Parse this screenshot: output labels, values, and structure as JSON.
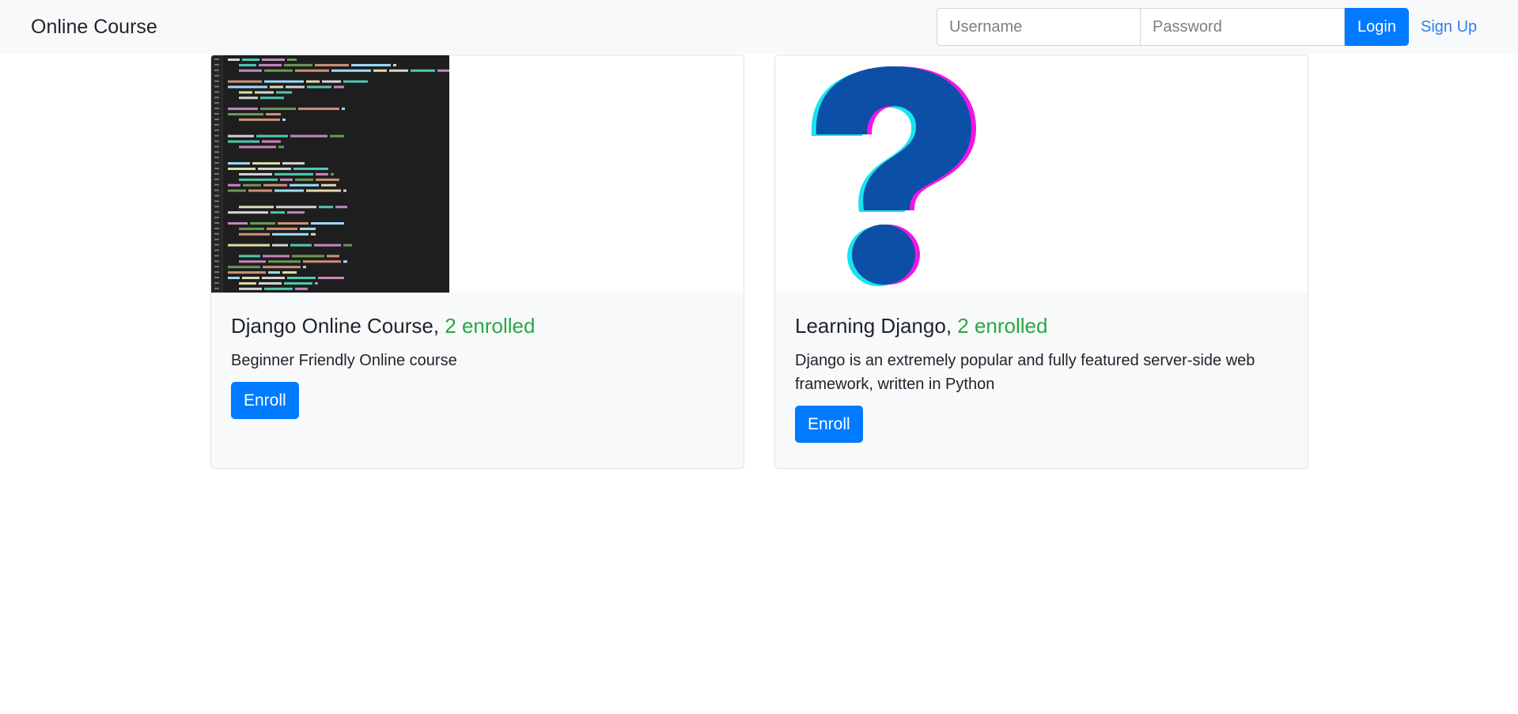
{
  "navbar": {
    "brand": "Online Course",
    "username_placeholder": "Username",
    "password_placeholder": "Password",
    "login_label": "Login",
    "signup_label": "Sign Up"
  },
  "courses": [
    {
      "name": "Django Online Course",
      "enrolled": "2 enrolled",
      "description": "Beginner Friendly Online course",
      "enroll_label": "Enroll",
      "image": "code-screenshot-image"
    },
    {
      "name": "Learning Django",
      "enrolled": "2 enrolled",
      "description": "Django is an extremely popular and fully featured server-side web framework, written in Python",
      "enroll_label": "Enroll",
      "image": "question-mark-image"
    }
  ],
  "colors": {
    "primary": "#007bff",
    "success": "#28a745",
    "navbar_bg": "#f8f9fa",
    "link": "#2f7fe8"
  }
}
